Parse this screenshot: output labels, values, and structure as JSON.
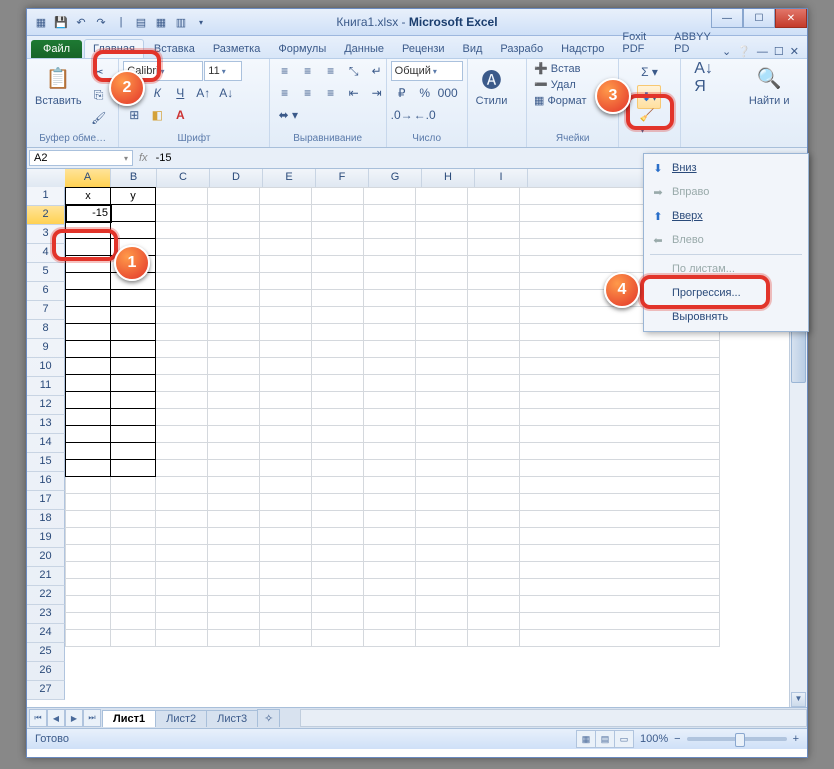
{
  "title": {
    "doc": "Книга1.xlsx",
    "app": "Microsoft Excel"
  },
  "tabs": {
    "file": "Файл",
    "home": "Главная",
    "insert": "Вставка",
    "layout": "Разметка",
    "formulas": "Формулы",
    "data": "Данные",
    "review": "Рецензи",
    "view": "Вид",
    "dev": "Разрабо",
    "addin": "Надстро",
    "foxit": "Foxit PDF",
    "abbyy": "ABBYY PD"
  },
  "groups": {
    "clipboard": "Буфер обме…",
    "font": "Шрифт",
    "align": "Выравнивание",
    "number": "Число",
    "styles": "Стили",
    "cells": "Ячейки"
  },
  "font": {
    "name": "Calibri",
    "size": "11"
  },
  "number_format": "Общий",
  "paste": "Вставить",
  "styles_btn": "Стили",
  "cells_menu": {
    "insert": "Встав",
    "delete": "Удал",
    "format": "Формат"
  },
  "find": "Найти и",
  "namebox": "A2",
  "formula": "-15",
  "cols": [
    "A",
    "B",
    "C",
    "D",
    "E",
    "F",
    "G",
    "H",
    "I"
  ],
  "row_count": 27,
  "header": {
    "x": "x",
    "y": "y"
  },
  "cell_a2": "-15",
  "sheets": {
    "s1": "Лист1",
    "s2": "Лист2",
    "s3": "Лист3"
  },
  "status": "Готово",
  "zoom": "100%",
  "fill_menu": {
    "down": "Вниз",
    "right": "Вправо",
    "up": "Вверх",
    "left": "Влево",
    "across": "По листам...",
    "series": "Прогрессия...",
    "justify": "Выровнять"
  },
  "chart_data": {
    "type": "table",
    "columns": [
      "x",
      "y"
    ],
    "rows": [
      [
        -15,
        null
      ]
    ]
  }
}
